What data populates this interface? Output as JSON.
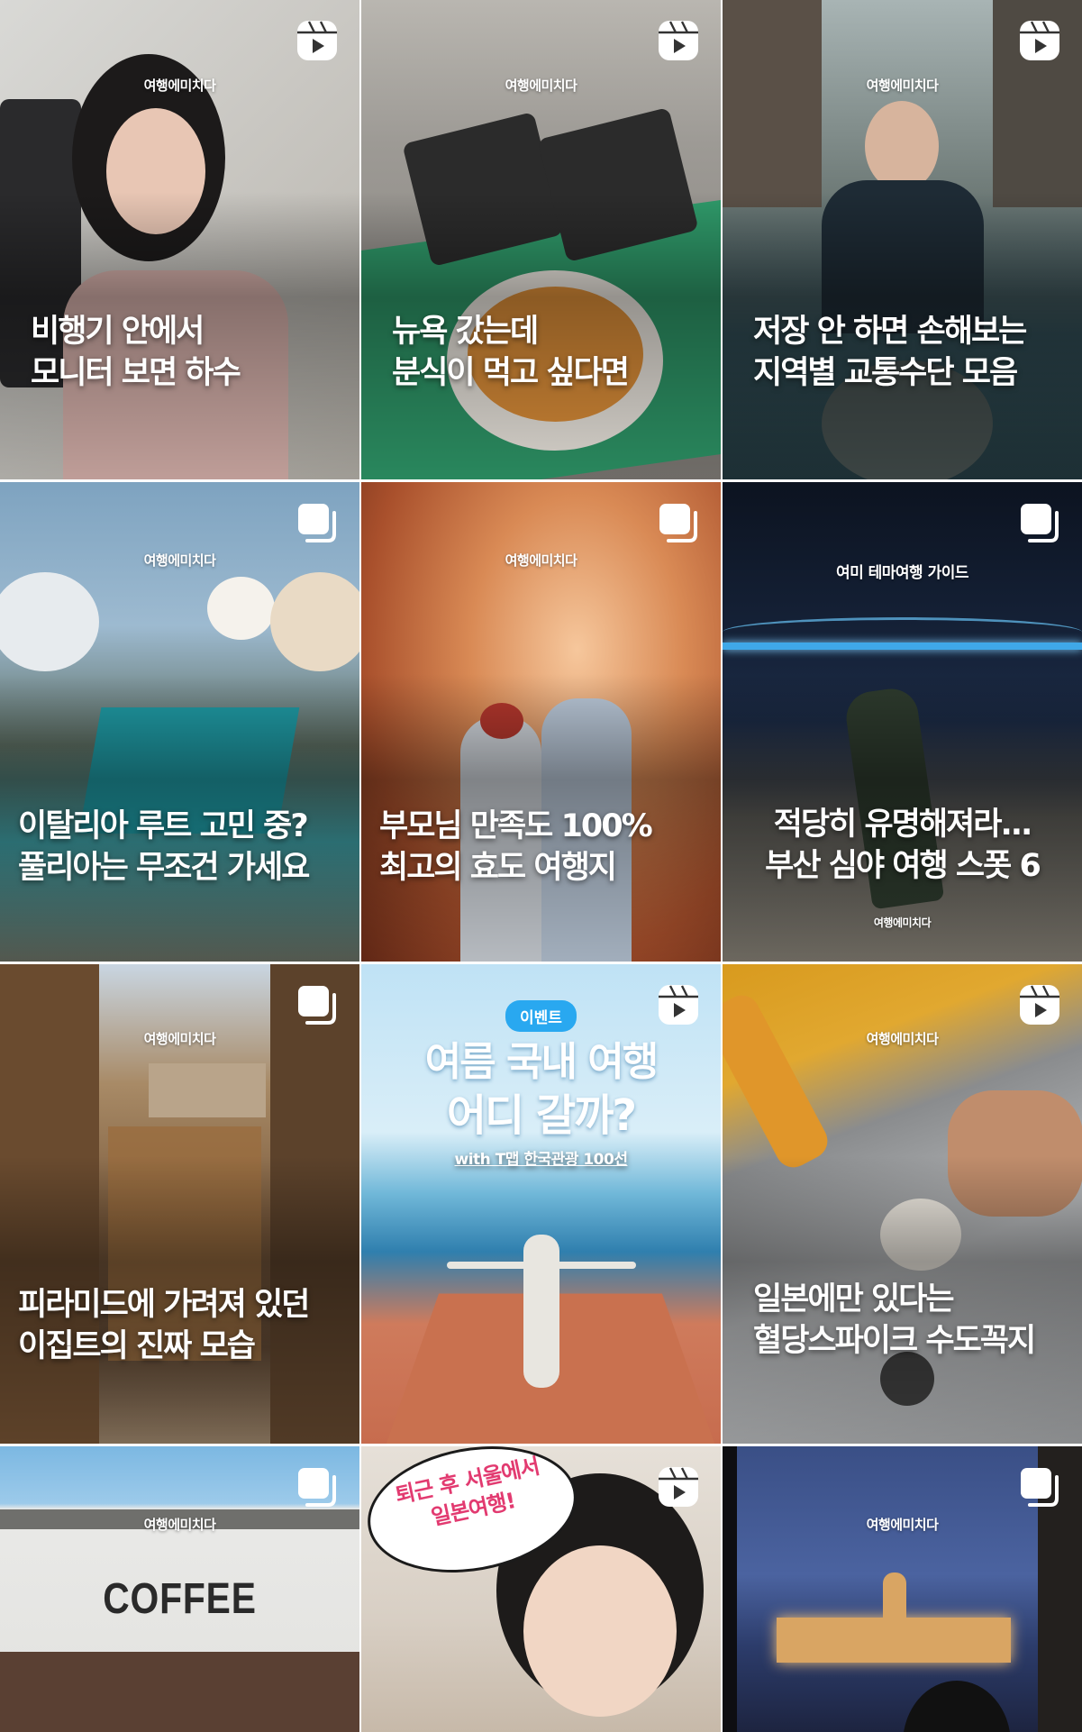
{
  "brand": "여행에미치다",
  "tiles": [
    {
      "caption": [
        "비행기 안에서",
        "모니터 보면 하수"
      ],
      "type": "reel",
      "type_icon": "reels-icon"
    },
    {
      "caption": [
        "뉴욕 갔는데",
        "분식이 먹고 싶다면"
      ],
      "type": "reel",
      "type_icon": "reels-icon"
    },
    {
      "caption": [
        "저장 안 하면 손해보는",
        "지역별 교통수단 모음"
      ],
      "type": "reel",
      "type_icon": "reels-icon"
    },
    {
      "caption": [
        "이탈리아 루트 고민 중?",
        "풀리아는 무조건 가세요"
      ],
      "type": "carousel",
      "type_icon": "carousel-icon"
    },
    {
      "caption": [
        "부모님 만족도 100%",
        "최고의 효도 여행지"
      ],
      "type": "carousel",
      "type_icon": "carousel-icon"
    },
    {
      "caption": [
        "적당히 유명해져라...",
        "부산 심야 여행 스폿 6"
      ],
      "type": "carousel",
      "type_icon": "carousel-icon",
      "brand_top": "여미 테마여행 가이드"
    },
    {
      "caption": [
        "피라미드에 가려져 있던",
        "이집트의 진짜 모습"
      ],
      "type": "carousel",
      "type_icon": "carousel-icon"
    },
    {
      "caption": [
        "여름 국내 여행",
        "어디 갈까?"
      ],
      "type": "reel",
      "type_icon": "reels-icon",
      "badge": "이벤트",
      "subline": "with T맵 한국관광 100선"
    },
    {
      "caption": [
        "일본에만 있다는",
        "혈당스파이크 수도꼭지"
      ],
      "type": "reel",
      "type_icon": "reels-icon"
    },
    {
      "caption": [],
      "type": "carousel",
      "type_icon": "carousel-icon",
      "sign": "COFFEE"
    },
    {
      "caption": [],
      "type": "reel",
      "type_icon": "reels-icon",
      "bubble": [
        "퇴근 후 서울에서",
        "일본여행!"
      ]
    },
    {
      "caption": [],
      "type": "carousel",
      "type_icon": "carousel-icon"
    }
  ]
}
